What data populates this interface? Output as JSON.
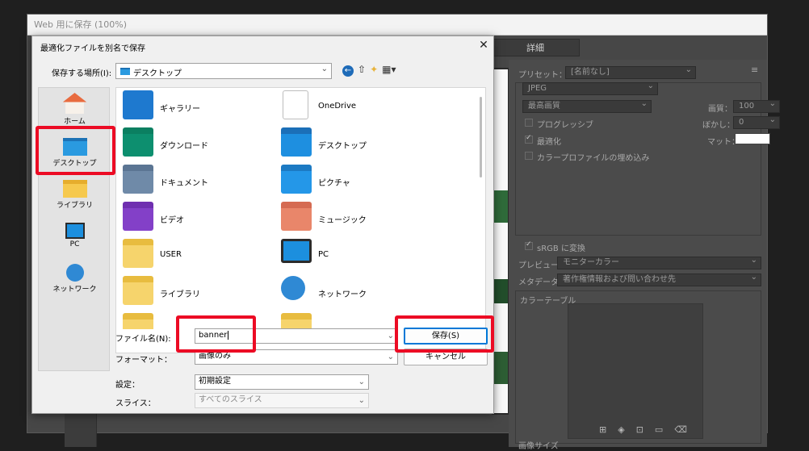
{
  "ps": {
    "title": "Web 用に保存 (100%)",
    "tab_detail": "詳細",
    "preset_label": "プリセット：",
    "preset_value": "[名前なし]",
    "format": "JPEG",
    "quality_preset": "最高画質",
    "quality_label": "画質：",
    "quality_value": "100",
    "progressive": "プログレッシブ",
    "blur_label": "ぼかし：",
    "blur_value": "0",
    "optimize": "最適化",
    "matte_label": "マット：",
    "embed_profile": "カラープロファイルの埋め込み",
    "srgb": "sRGB に変換",
    "preview_label": "プレビュー：",
    "preview_value": "モニターカラー",
    "metadata_label": "メタデータ：",
    "metadata_value": "著作権情報および問い合わせ先",
    "color_table": "カラーテーブル",
    "image_size": "画像サイズ"
  },
  "dialog": {
    "title": "最適化ファイルを別名で保存",
    "location_label": "保存する場所(I):",
    "location_value": "デスクトップ",
    "places": [
      {
        "label": "ホーム"
      },
      {
        "label": "デスクトップ"
      },
      {
        "label": "ライブラリ"
      },
      {
        "label": "PC"
      },
      {
        "label": "ネットワーク"
      }
    ],
    "files": [
      {
        "name": "ギャラリー"
      },
      {
        "name": "OneDrive"
      },
      {
        "name": "ダウンロード"
      },
      {
        "name": "デスクトップ"
      },
      {
        "name": "ドキュメント"
      },
      {
        "name": "ピクチャ"
      },
      {
        "name": "ビデオ"
      },
      {
        "name": "ミュージック"
      },
      {
        "name": "USER"
      },
      {
        "name": "PC"
      },
      {
        "name": "ライブラリ"
      },
      {
        "name": "ネットワーク"
      }
    ],
    "filename_label": "ファイル名(N):",
    "filename_value": "banner",
    "format_label": "フォーマット：",
    "format_value": "画像のみ",
    "settings_label": "設定：",
    "settings_value": "初期設定",
    "slice_label": "スライス：",
    "slice_value": "すべてのスライス",
    "save_button": "保存(S)",
    "cancel_button": "キャンセル"
  },
  "colors": {
    "highlight": "#ec0b24",
    "accent": "#0078d7"
  }
}
